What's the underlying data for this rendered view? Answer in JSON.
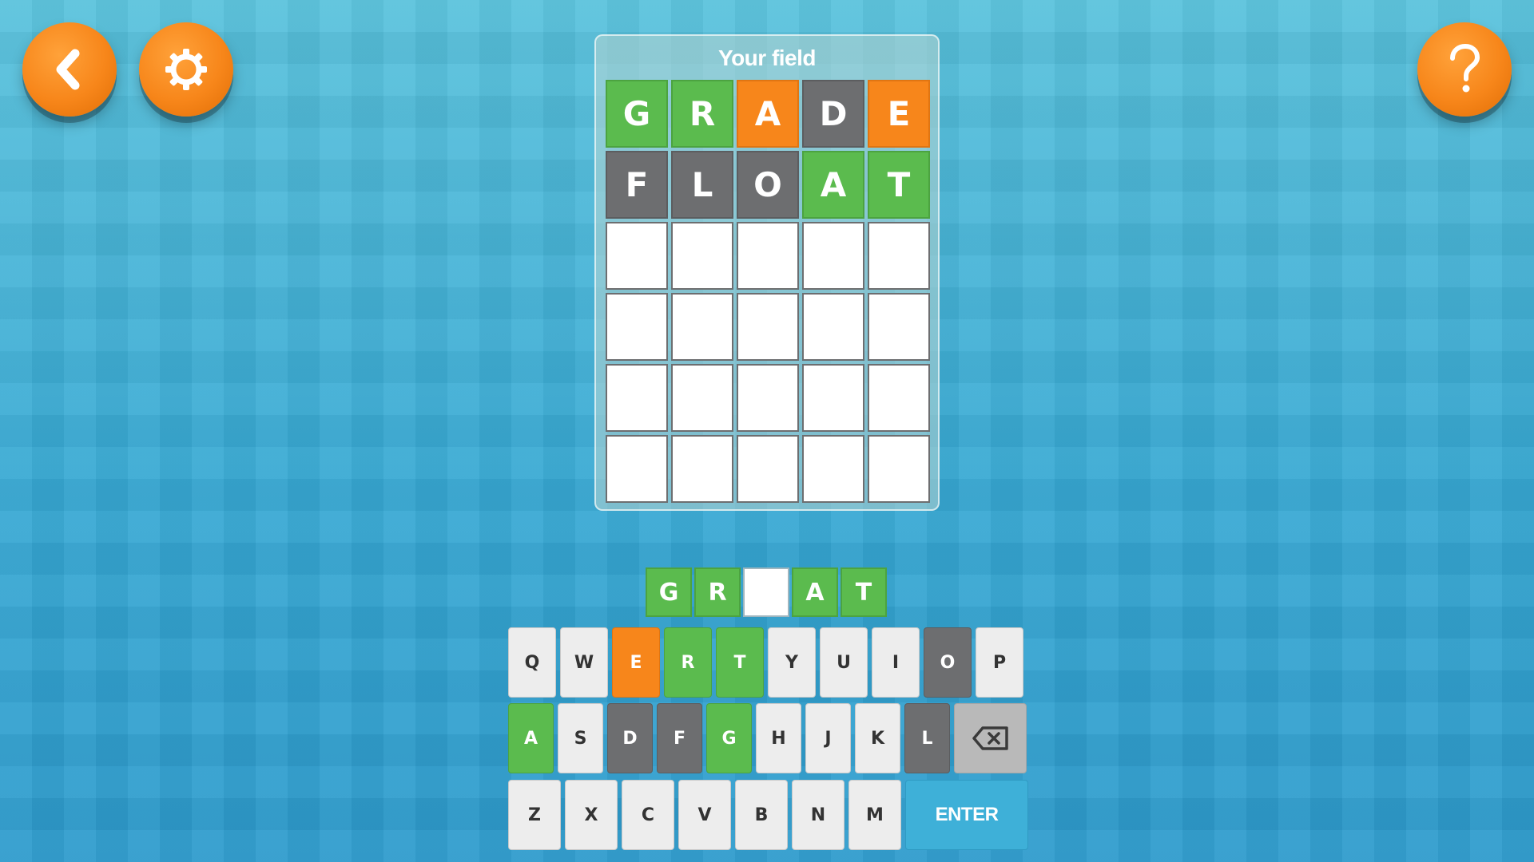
{
  "toolbar": {
    "back_icon": "chevron-left-icon",
    "settings_icon": "gear-icon",
    "help_icon": "question-mark-icon"
  },
  "colors": {
    "correct": "#5bbb4e",
    "present": "#f7861b",
    "absent": "#6d6e70",
    "button": "#f7861a",
    "enter": "#3eb0d8"
  },
  "field": {
    "title": "Your field",
    "rows": [
      [
        {
          "letter": "G",
          "state": "green"
        },
        {
          "letter": "R",
          "state": "green"
        },
        {
          "letter": "A",
          "state": "orange"
        },
        {
          "letter": "D",
          "state": "gray"
        },
        {
          "letter": "E",
          "state": "orange"
        }
      ],
      [
        {
          "letter": "F",
          "state": "gray"
        },
        {
          "letter": "L",
          "state": "gray"
        },
        {
          "letter": "O",
          "state": "gray"
        },
        {
          "letter": "A",
          "state": "green"
        },
        {
          "letter": "T",
          "state": "green"
        }
      ],
      [
        {
          "letter": "",
          "state": "empty"
        },
        {
          "letter": "",
          "state": "empty"
        },
        {
          "letter": "",
          "state": "empty"
        },
        {
          "letter": "",
          "state": "empty"
        },
        {
          "letter": "",
          "state": "empty"
        }
      ],
      [
        {
          "letter": "",
          "state": "empty"
        },
        {
          "letter": "",
          "state": "empty"
        },
        {
          "letter": "",
          "state": "empty"
        },
        {
          "letter": "",
          "state": "empty"
        },
        {
          "letter": "",
          "state": "empty"
        }
      ],
      [
        {
          "letter": "",
          "state": "empty"
        },
        {
          "letter": "",
          "state": "empty"
        },
        {
          "letter": "",
          "state": "empty"
        },
        {
          "letter": "",
          "state": "empty"
        },
        {
          "letter": "",
          "state": "empty"
        }
      ],
      [
        {
          "letter": "",
          "state": "empty"
        },
        {
          "letter": "",
          "state": "empty"
        },
        {
          "letter": "",
          "state": "empty"
        },
        {
          "letter": "",
          "state": "empty"
        },
        {
          "letter": "",
          "state": "empty"
        }
      ]
    ]
  },
  "hint": [
    {
      "letter": "G",
      "state": "green"
    },
    {
      "letter": "R",
      "state": "green"
    },
    {
      "letter": "",
      "state": "empty"
    },
    {
      "letter": "A",
      "state": "green"
    },
    {
      "letter": "T",
      "state": "green"
    }
  ],
  "keyboard": {
    "row1": [
      {
        "key": "Q",
        "state": "default"
      },
      {
        "key": "W",
        "state": "default"
      },
      {
        "key": "E",
        "state": "orange"
      },
      {
        "key": "R",
        "state": "green"
      },
      {
        "key": "T",
        "state": "green"
      },
      {
        "key": "Y",
        "state": "default"
      },
      {
        "key": "U",
        "state": "default"
      },
      {
        "key": "I",
        "state": "default"
      },
      {
        "key": "O",
        "state": "gray"
      },
      {
        "key": "P",
        "state": "default"
      }
    ],
    "row2": [
      {
        "key": "A",
        "state": "green"
      },
      {
        "key": "S",
        "state": "default"
      },
      {
        "key": "D",
        "state": "gray"
      },
      {
        "key": "F",
        "state": "gray"
      },
      {
        "key": "G",
        "state": "green"
      },
      {
        "key": "H",
        "state": "default"
      },
      {
        "key": "J",
        "state": "default"
      },
      {
        "key": "K",
        "state": "default"
      },
      {
        "key": "L",
        "state": "gray"
      }
    ],
    "row3": [
      {
        "key": "Z",
        "state": "default"
      },
      {
        "key": "X",
        "state": "default"
      },
      {
        "key": "C",
        "state": "default"
      },
      {
        "key": "V",
        "state": "default"
      },
      {
        "key": "B",
        "state": "default"
      },
      {
        "key": "N",
        "state": "default"
      },
      {
        "key": "M",
        "state": "default"
      }
    ],
    "backspace_icon": "backspace-icon",
    "enter_label": "ENTER"
  }
}
